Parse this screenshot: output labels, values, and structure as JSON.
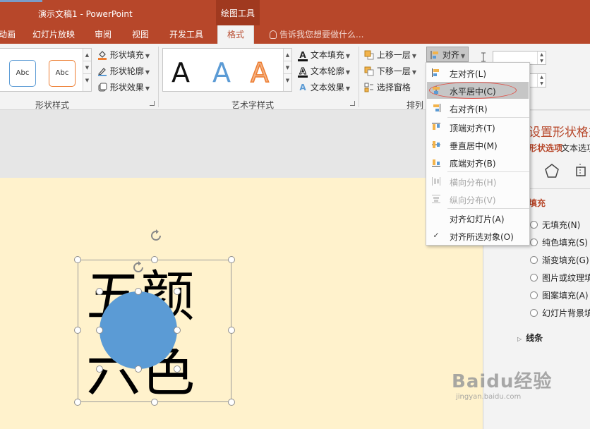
{
  "window": {
    "title": "演示文稿1 - PowerPoint",
    "context_group": "绘图工具"
  },
  "tabs": [
    "动画",
    "幻灯片放映",
    "审阅",
    "视图",
    "开发工具",
    "格式"
  ],
  "active_tab": "格式",
  "tell_me": "告诉我您想要做什么...",
  "ribbon": {
    "shape_styles": {
      "label": "形状样式",
      "sample_text": "Abc",
      "fill": "形状填充",
      "outline": "形状轮廓",
      "effects": "形状效果"
    },
    "wordart": {
      "label": "艺术字样式",
      "sample": "A",
      "text_fill": "文本填充",
      "text_outline": "文本轮廓",
      "text_effects": "文本效果"
    },
    "arrange": {
      "label": "排列",
      "bring_forward": "上移一层",
      "send_backward": "下移一层",
      "selection_pane": "选择窗格",
      "align": "对齐"
    }
  },
  "align_menu": {
    "items": [
      {
        "label": "左对齐(L)",
        "state": "normal"
      },
      {
        "label": "水平居中(C)",
        "state": "hover"
      },
      {
        "label": "右对齐(R)",
        "state": "normal"
      },
      {
        "label": "顶端对齐(T)",
        "state": "normal"
      },
      {
        "label": "垂直居中(M)",
        "state": "normal"
      },
      {
        "label": "底端对齐(B)",
        "state": "normal"
      },
      {
        "label": "横向分布(H)",
        "state": "disabled"
      },
      {
        "label": "纵向分布(V)",
        "state": "disabled"
      },
      {
        "label": "对齐幻灯片(A)",
        "state": "normal"
      },
      {
        "label": "对齐所选对象(O)",
        "state": "checked"
      }
    ]
  },
  "slide": {
    "chars": [
      "五",
      "颜",
      "六",
      "色"
    ]
  },
  "format_pane": {
    "title": "设置形状格式",
    "tab_shape": "形状选项",
    "tab_text": "文本选项",
    "fill_section": "填充",
    "fill_options": [
      "无填充(N)",
      "纯色填充(S)",
      "渐变填充(G)",
      "图片或纹理填充(P)",
      "图案填充(A)",
      "幻灯片背景填充(B)"
    ],
    "line_section": "线条"
  },
  "watermark": {
    "main": "Baidu经验",
    "sub": "jingyan.baidu.com"
  },
  "colors": {
    "accent": "#b7472a",
    "shape_fill": "#5b9bd5",
    "slide_bg": "#fff2cc",
    "highlight_ellipse": "#e0524a"
  }
}
